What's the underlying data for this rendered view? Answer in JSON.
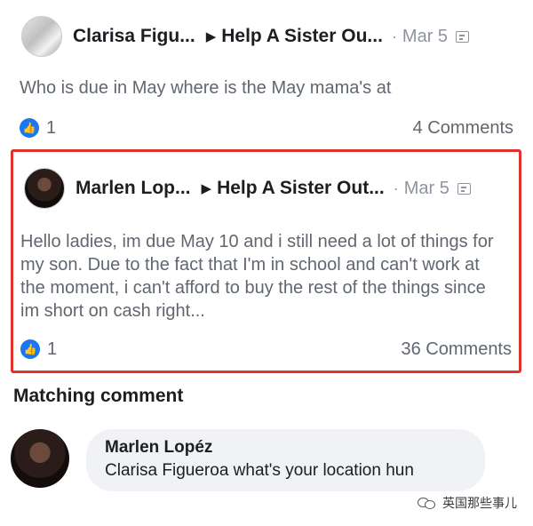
{
  "posts": [
    {
      "author": "Clarisa Figu...",
      "group": "Help A Sister Ou...",
      "date": "Mar 5",
      "text": "Who is due in May where is the May mama's at",
      "likes": "1",
      "comments": "4 Comments"
    },
    {
      "author": "Marlen Lop...",
      "group": "Help A Sister Out...",
      "date": "Mar 5",
      "text": "Hello ladies, im due May 10 and i still need a lot of things for my son. Due to the fact that I'm in school and can't work at the moment, i can't afford to buy the rest of the things since im short on cash right...",
      "likes": "1",
      "comments": "36 Comments"
    }
  ],
  "matching_comment": {
    "title": "Matching comment",
    "author": "Marlen Lopéz",
    "text": "Clarisa Figueroa what's your location hun"
  },
  "watermark": "英国那些事儿",
  "glyphs": {
    "arrow": "▶",
    "dot": "·",
    "thumb": "👍"
  },
  "colors": {
    "highlight_border": "#e0322c",
    "like_blue": "#1877f2",
    "secondary_text": "#606770"
  }
}
